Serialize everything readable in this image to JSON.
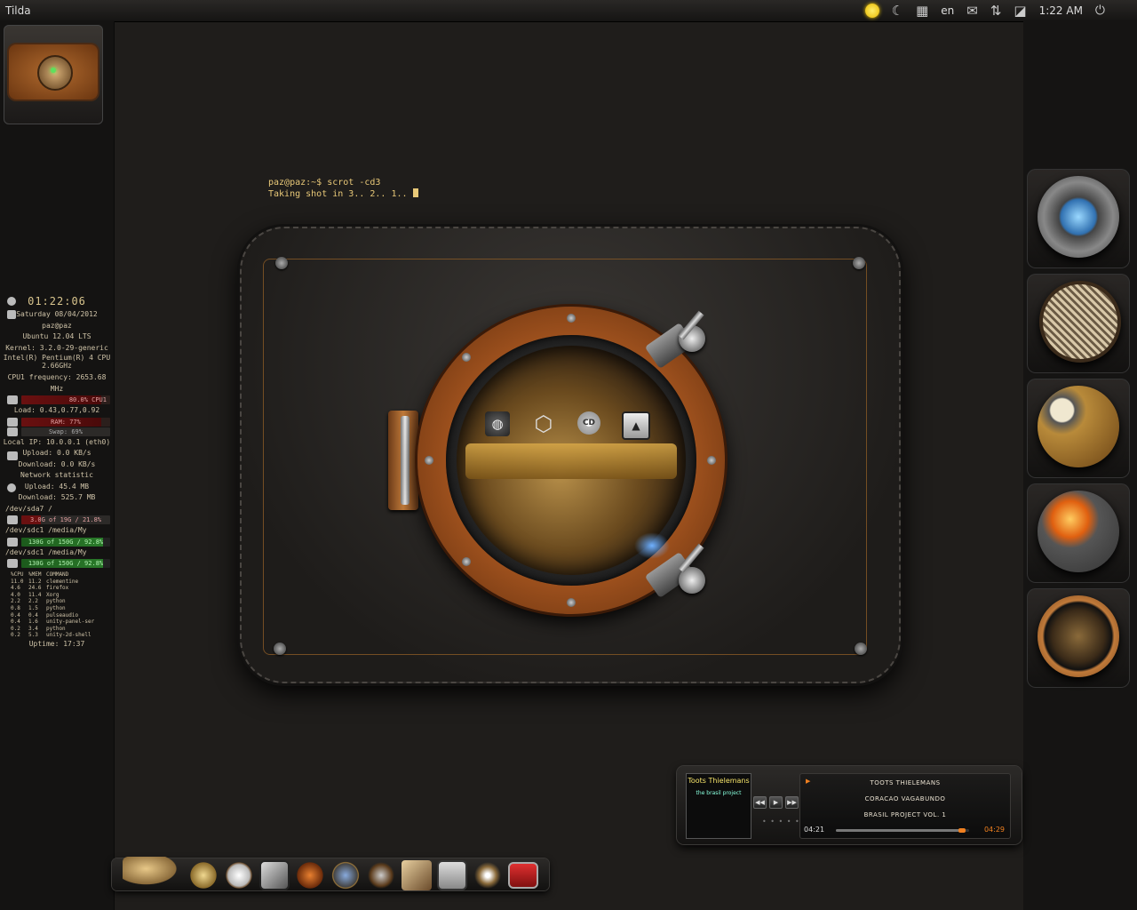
{
  "top_panel": {
    "title": "Tilda",
    "keyboard_layout": "en",
    "clock": "1:22 AM",
    "icons": [
      "sun-icon",
      "weather-icon",
      "workspace-icon",
      "mail-icon",
      "network-icon",
      "rss-icon",
      "power-icon"
    ]
  },
  "terminal": {
    "line1": "paz@paz:~$ scrot -cd3",
    "line2": "Taking shot in 3.. 2.. 1.."
  },
  "conky": {
    "time": "01:22:06",
    "date": "Saturday 08/04/2012",
    "host": "paz@paz",
    "os": "Ubuntu 12.04 LTS",
    "kernel": "Kernel: 3.2.0-29-generic",
    "cpu_model": "Intel(R) Pentium(R) 4 CPU",
    "cpu_speed": "2.66GHz",
    "cpu_freq": "CPU1 frequency: 2653.68 MHz",
    "cpu_bar": "80.0% CPU1",
    "load": "Load: 0.43,0.77,0.92",
    "ram_bar": "RAM: 77%",
    "swap_bar": "Swap: 69%",
    "local_ip": "Local IP: 10.0.0.1 (eth0)",
    "upload": "Upload: 0.0 KB/s",
    "download": "Download: 0.0 KB/s",
    "net_title": "Network statistic",
    "net_upload": "Upload: 45.4 MB",
    "net_download": "Download: 525.7 MB",
    "disk1_label": "/dev/sda7   /",
    "disk1_bar": "3.0G of 19G / 21.8%",
    "disk2_label": "/dev/sdc1   /media/My",
    "disk2_bar": "130G of 150G / 92.8%",
    "disk3_label": "/dev/sdc1   /media/My",
    "disk3_bar": "130G of 150G / 92.8%",
    "proc_header": [
      "%CPU",
      "%MEM",
      "COMMAND"
    ],
    "procs": [
      [
        "11.0",
        "11.2",
        "clementine"
      ],
      [
        "4.6",
        "24.6",
        "firefox"
      ],
      [
        "4.0",
        "11.4",
        "Xorg"
      ],
      [
        "2.2",
        "2.2",
        "python"
      ],
      [
        "0.8",
        "1.5",
        "python"
      ],
      [
        "0.4",
        "0.4",
        "pulseaudio"
      ],
      [
        "0.4",
        "1.6",
        "unity-panel-ser"
      ],
      [
        "0.2",
        "3.4",
        "python"
      ],
      [
        "0.2",
        "5.3",
        "unity-2d-shell"
      ]
    ],
    "uptime": "Uptime: 17:37"
  },
  "player": {
    "album_cover_title": "Toots Thielemans",
    "album_cover_sub": "the brasil project",
    "artist": "TOOTS THIELEMANS",
    "track": "CORACAO VAGABUNDO",
    "album": "BRASIL PROJECT VOL. 1",
    "elapsed": "04:21",
    "total": "04:29",
    "progress_fraction": 0.97,
    "controls": [
      "prev-button",
      "play-button",
      "next-button"
    ]
  },
  "colors": {
    "terminal_text": "#e8c878",
    "accent_orange": "#f08020",
    "copper": "#a0521e"
  }
}
